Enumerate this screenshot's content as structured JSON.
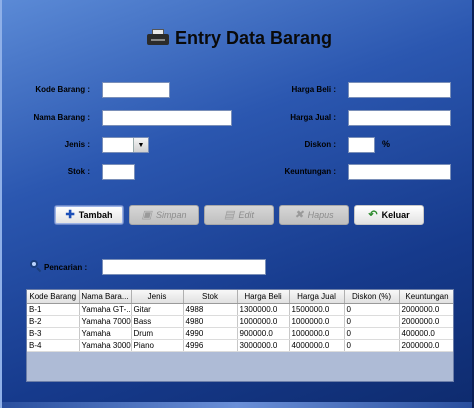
{
  "header": {
    "title": "Entry Data Barang",
    "icon": "printer-icon"
  },
  "form": {
    "kode_barang": {
      "label": "Kode Barang :",
      "value": ""
    },
    "nama_barang": {
      "label": "Nama Barang :",
      "value": ""
    },
    "jenis": {
      "label": "Jenis :",
      "value": ""
    },
    "stok": {
      "label": "Stok :",
      "value": ""
    },
    "harga_beli": {
      "label": "Harga Beli :",
      "value": ""
    },
    "harga_jual": {
      "label": "Harga Jual :",
      "value": ""
    },
    "diskon": {
      "label": "Diskon :",
      "value": "",
      "unit": "%"
    },
    "keuntungan": {
      "label": "Keuntungan :",
      "value": ""
    }
  },
  "toolbar": {
    "tambah": {
      "label": "Tambah",
      "icon": "plus-icon",
      "enabled": true
    },
    "simpan": {
      "label": "Simpan",
      "icon": "save-icon",
      "enabled": false
    },
    "edit": {
      "label": "Edit",
      "icon": "edit-icon",
      "enabled": false
    },
    "hapus": {
      "label": "Hapus",
      "icon": "delete-x-icon",
      "enabled": false
    },
    "keluar": {
      "label": "Keluar",
      "icon": "exit-arrow-icon",
      "enabled": true
    }
  },
  "search": {
    "label": "Pencarian :",
    "value": "",
    "icon": "search-icon"
  },
  "table": {
    "columns": [
      "Kode Barang",
      "Nama Bara...",
      "Jenis",
      "Stok",
      "Harga Beli",
      "Harga Jual",
      "Diskon (%)",
      "Keuntungan"
    ],
    "rows": [
      [
        "B-1",
        "Yamaha GT-...",
        "Gitar",
        "4988",
        "1300000.0",
        "1500000.0",
        "0",
        "2000000.0"
      ],
      [
        "B-2",
        "Yamaha 7000",
        "Bass",
        "4980",
        "1000000.0",
        "1000000.0",
        "0",
        "2000000.0"
      ],
      [
        "B-3",
        "Yamaha",
        "Drum",
        "4990",
        "900000.0",
        "1000000.0",
        "0",
        "400000.0"
      ],
      [
        "B-4",
        "Yamaha 3000",
        "Piano",
        "4996",
        "3000000.0",
        "4000000.0",
        "0",
        "2000000.0"
      ]
    ]
  },
  "colors": {
    "window_bg": "#2b57b0",
    "accent": "#1a3e7a"
  }
}
